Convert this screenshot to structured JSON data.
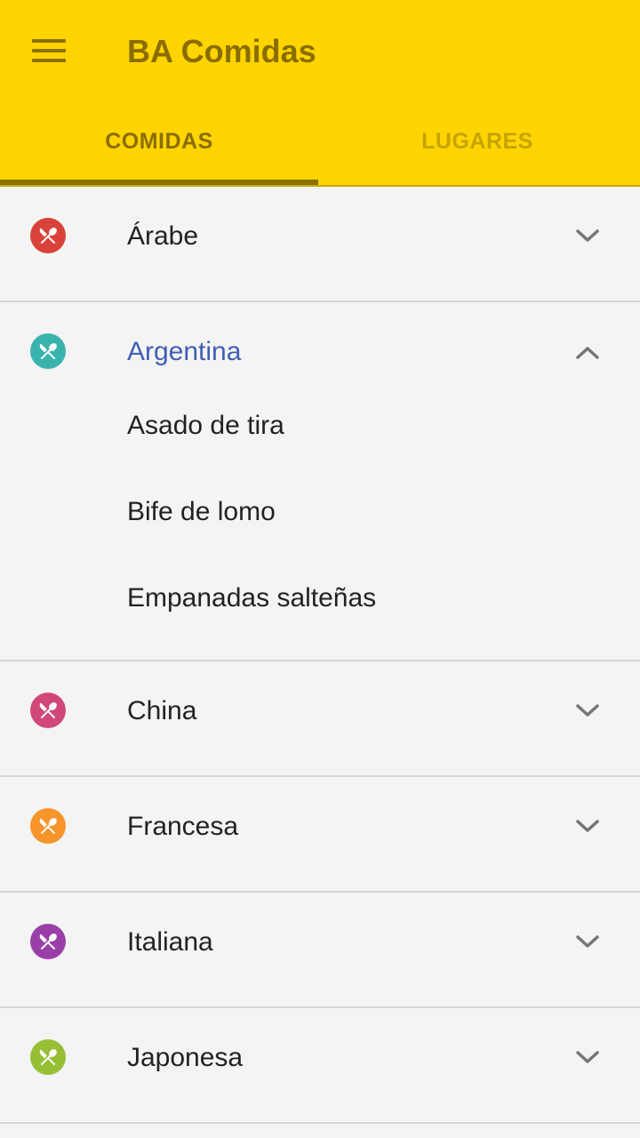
{
  "app": {
    "title": "BA Comidas",
    "menu_icon": "hamburger-menu-icon",
    "bar_color": "#ffd400"
  },
  "tabs": [
    {
      "label": "COMIDAS",
      "selected": true
    },
    {
      "label": "LUGARES",
      "selected": false
    }
  ],
  "categories": [
    {
      "label": "Árabe",
      "icon": "restaurant-icon",
      "color": "#d9423a",
      "expanded": false,
      "items": []
    },
    {
      "label": "Argentina",
      "icon": "restaurant-icon",
      "color": "#3bb3ad",
      "expanded": true,
      "items": [
        "Asado de tira",
        "Bife de lomo",
        "Empanadas salteñas"
      ]
    },
    {
      "label": "China",
      "icon": "restaurant-icon",
      "color": "#d2477a",
      "expanded": false,
      "items": []
    },
    {
      "label": "Francesa",
      "icon": "restaurant-icon",
      "color": "#f7942b",
      "expanded": false,
      "items": []
    },
    {
      "label": "Italiana",
      "icon": "restaurant-icon",
      "color": "#9a3fa8",
      "expanded": false,
      "items": []
    },
    {
      "label": "Japonesa",
      "icon": "restaurant-icon",
      "color": "#97be35",
      "expanded": false,
      "items": []
    }
  ]
}
